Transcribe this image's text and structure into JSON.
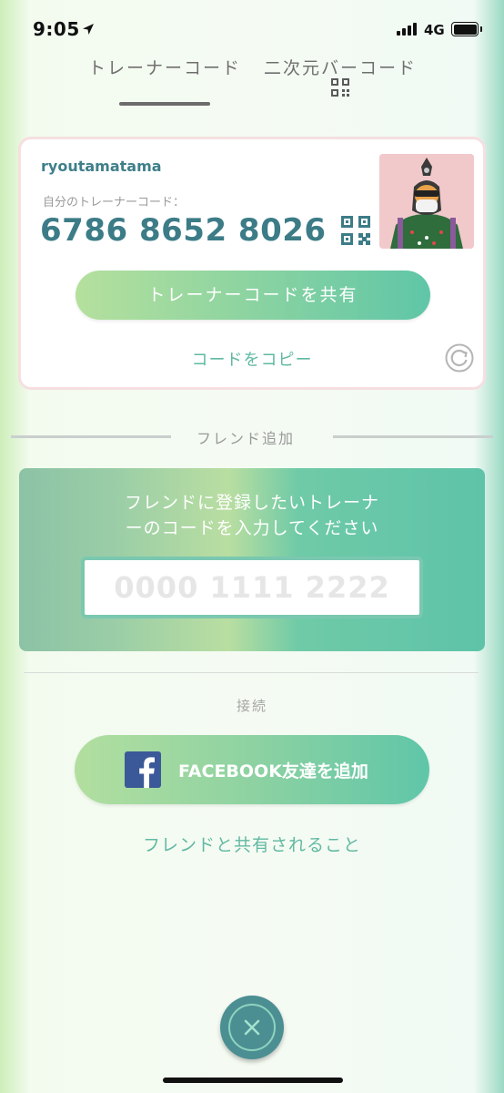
{
  "status_bar": {
    "time": "9:05",
    "network": "4G",
    "icons": [
      "location-arrow-icon",
      "signal-bars-icon",
      "battery-icon"
    ]
  },
  "tabs": [
    {
      "label": "トレーナーコード",
      "active": true
    },
    {
      "label": "二次元バーコード",
      "active": false,
      "icon": "qr-code-icon"
    }
  ],
  "trainer_card": {
    "username": "ryoutamatama",
    "code_label": "自分のトレーナーコード：",
    "trainer_code": "6786 8652 8026",
    "share_button_label": "トレーナーコードを共有",
    "copy_label": "コードをコピー",
    "icons": [
      "qr-code-icon",
      "avatar-image",
      "refresh-icon"
    ]
  },
  "friend_add": {
    "section_title": "フレンド追加",
    "prompt_line1": "フレンドに登録したいトレーナ",
    "prompt_line2": "ーのコードを入力してください",
    "input_placeholder": "0000 1111 2222",
    "input_value": ""
  },
  "connect": {
    "section_title": "接続",
    "facebook_button_label": "FACEBOOK友達を追加",
    "share_info_label": "フレンドと共有されること"
  },
  "colors": {
    "accent_teal": "#3c7c87",
    "link_green": "#5fb9a2",
    "facebook_blue": "#3b5998",
    "close_button": "#4c8f93"
  }
}
